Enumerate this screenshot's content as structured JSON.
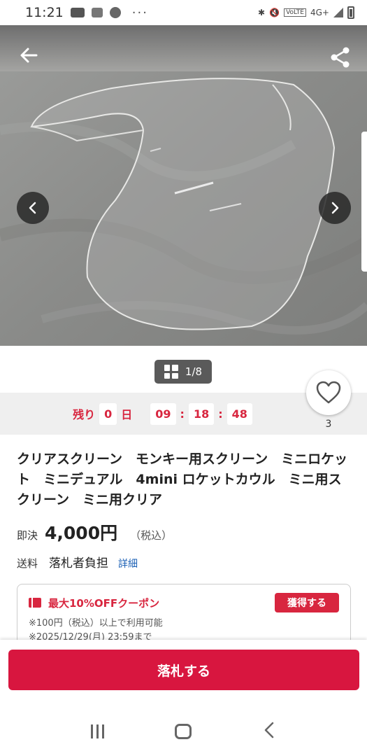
{
  "statusbar": {
    "time": "11:21",
    "dots": "···",
    "network": "4G+"
  },
  "gallery": {
    "counter": "1/8",
    "back_icon": "arrow-left-icon",
    "share_icon": "share-icon",
    "prev_icon": "chevron-left-icon",
    "next_icon": "chevron-right-icon"
  },
  "timer": {
    "remaining_label": "残り",
    "days": "0",
    "day_unit": "日",
    "hours": "09",
    "minutes": "18",
    "seconds": "48",
    "sep": ":"
  },
  "favorite": {
    "count": "3",
    "icon": "heart-icon"
  },
  "item": {
    "title": "クリアスクリーン　モンキー用スクリーン　ミニロケット　ミニデュアル　4mini ロケットカウル　ミニ用スクリーン　ミニ用クリア",
    "price_label": "即決",
    "price": "4,000円",
    "tax": "（税込）",
    "shipping_label": "送料",
    "shipping_value": "落札者負担",
    "shipping_link": "詳細"
  },
  "coupon": {
    "title": "最大10%OFFクーポン",
    "button": "獲得する",
    "note1": "※100円（税込）以上で利用可能",
    "note2": "※2025/12/29(月) 23:59まで"
  },
  "actions": {
    "bid_button": "落札する"
  },
  "colors": {
    "accent": "#d8163f",
    "link": "#1a5fb4"
  }
}
